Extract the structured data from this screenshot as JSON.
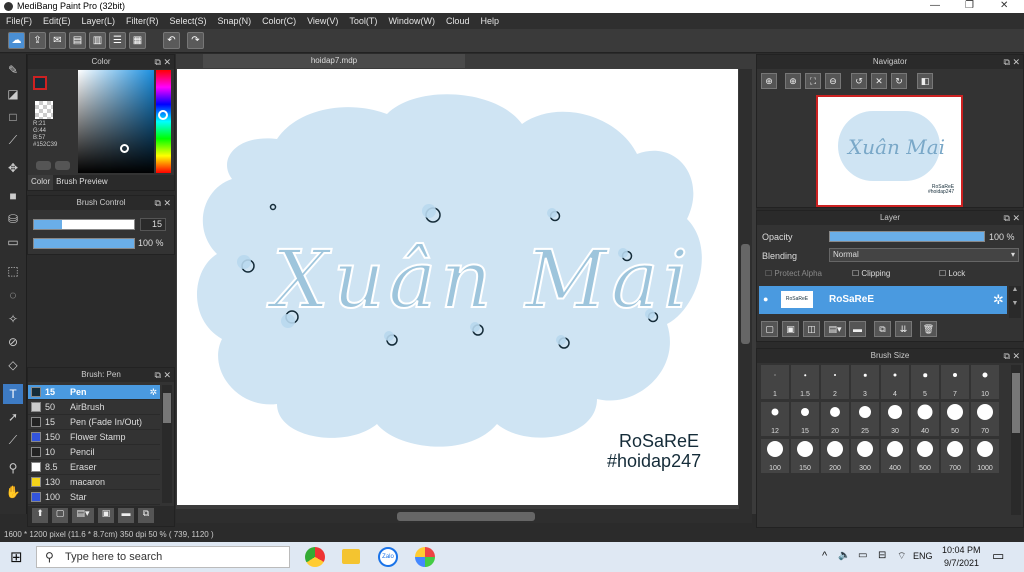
{
  "window": {
    "title": "MediBang Paint Pro (32bit)",
    "minimize": "—",
    "maximize": "❐",
    "close": "✕"
  },
  "menu": [
    "File(F)",
    "Edit(E)",
    "Layer(L)",
    "Filter(R)",
    "Select(S)",
    "Snap(N)",
    "Color(C)",
    "View(V)",
    "Tool(T)",
    "Window(W)",
    "Cloud",
    "Help"
  ],
  "document": {
    "tab_title": "hoidap7.mdp"
  },
  "color_panel": {
    "title": "Color",
    "r": "R:21",
    "g": "G:44",
    "b": "B:57",
    "hex": "#152C39",
    "tabs": [
      "Color",
      "Brush Preview"
    ]
  },
  "brush_control": {
    "title": "Brush Control",
    "size_value": "15",
    "opacity_value": "100 %",
    "size_level": 0.28,
    "opacity_level": 1.0
  },
  "brush_panel": {
    "title": "Brush: Pen",
    "brushes": [
      {
        "size": "15",
        "name": "Pen",
        "color": "#152C39",
        "selected": true
      },
      {
        "size": "50",
        "name": "AirBrush",
        "color": "#cccccc",
        "selected": false
      },
      {
        "size": "15",
        "name": "Pen (Fade In/Out)",
        "color": "#222222",
        "selected": false
      },
      {
        "size": "150",
        "name": "Flower Stamp",
        "color": "#3355dd",
        "selected": false
      },
      {
        "size": "10",
        "name": "Pencil",
        "color": "#222222",
        "selected": false
      },
      {
        "size": "8.5",
        "name": "Eraser",
        "color": "#ffffff",
        "selected": false
      },
      {
        "size": "130",
        "name": "macaron",
        "color": "#f2d21a",
        "selected": false
      },
      {
        "size": "100",
        "name": "Star",
        "color": "#3355dd",
        "selected": false
      }
    ]
  },
  "artwork": {
    "title_text": "Xuân Mai",
    "signature": "RoSaReE",
    "hashtag": "#hoidap247"
  },
  "navigator": {
    "title": "Navigator"
  },
  "layer_panel": {
    "title": "Layer",
    "opacity_label": "Opacity",
    "opacity_value": "100 %",
    "blending_label": "Blending",
    "blending_value": "Normal",
    "protect_alpha": "Protect Alpha",
    "clipping": "Clipping",
    "lock": "Lock",
    "layer_name": "RoSaReE"
  },
  "brush_size": {
    "title": "Brush Size",
    "sizes": [
      "1",
      "1.5",
      "2",
      "3",
      "4",
      "5",
      "7",
      "10",
      "12",
      "15",
      "20",
      "25",
      "30",
      "40",
      "50",
      "70",
      "100",
      "150",
      "200",
      "300",
      "400",
      "500",
      "700",
      "1000"
    ]
  },
  "status": {
    "text": "1600 * 1200 pixel   (11.6 * 8.7cm)   350 dpi   50 %   ( 739, 1120 )"
  },
  "taskbar": {
    "search_placeholder": "Type here to search",
    "lang": "ENG",
    "time": "10:04 PM",
    "date": "9/7/2021"
  },
  "colors": {
    "accent": "#4a9ae0",
    "cloud": "#cfe4f3",
    "ink": "#152C39",
    "lettering": "#9ec5dc"
  }
}
